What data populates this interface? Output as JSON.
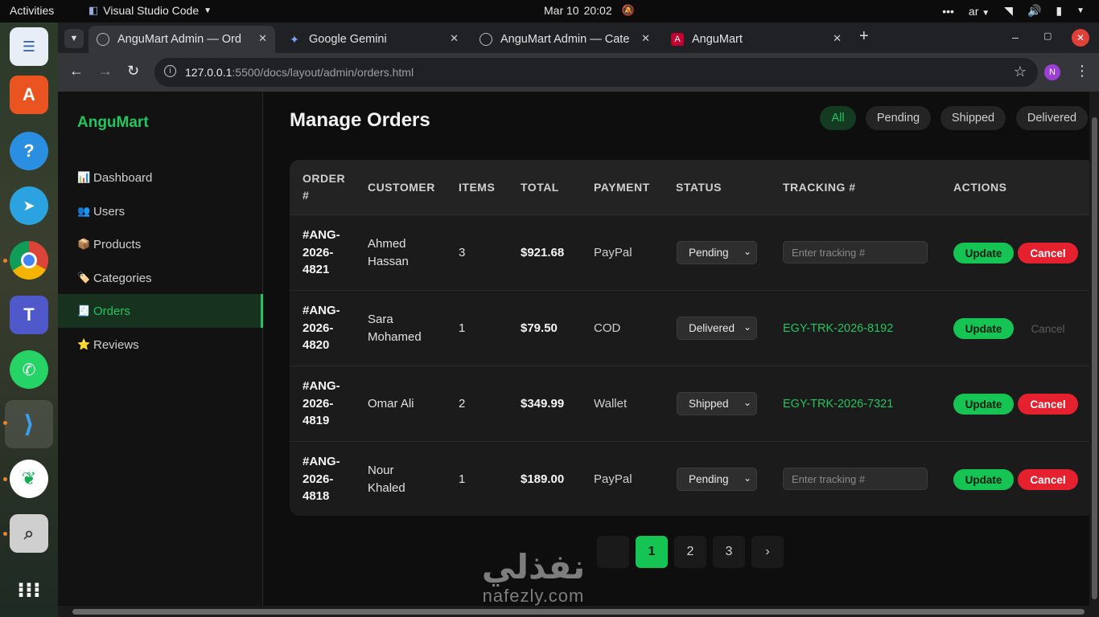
{
  "system": {
    "activities": "Activities",
    "app_name": "Visual Studio Code",
    "date": "Mar 10",
    "time": "20:02",
    "lang": "ar"
  },
  "dock": {
    "apps": [
      "text-editor-icon",
      "app-center-icon",
      "help-icon",
      "telegram-icon",
      "chrome-icon",
      "teams-linux-icon",
      "whatsapp-icon",
      "vscode-icon",
      "mongodb-icon",
      "screenshot-icon",
      "app-grid-icon"
    ]
  },
  "browser": {
    "tabs": [
      {
        "title": "AnguMart Admin — Ord"
      },
      {
        "title": "Google Gemini"
      },
      {
        "title": "AnguMart Admin — Cate"
      },
      {
        "title": "AnguMart"
      }
    ],
    "url_host": "127.0.0.1",
    "url_path": ":5500/docs/layout/admin/orders.html",
    "profile_initial": "N"
  },
  "sidebar": {
    "brand": "AnguMart",
    "items": [
      {
        "icon": "📊",
        "label": "Dashboard"
      },
      {
        "icon": "👥",
        "label": "Users"
      },
      {
        "icon": "📦",
        "label": "Products"
      },
      {
        "icon": "🏷️",
        "label": "Categories"
      },
      {
        "icon": "🧾",
        "label": "Orders"
      },
      {
        "icon": "⭐",
        "label": "Reviews"
      }
    ]
  },
  "main": {
    "title": "Manage Orders",
    "filters": [
      "All",
      "Pending",
      "Shipped",
      "Delivered"
    ],
    "columns": [
      "ORDER #",
      "CUSTOMER",
      "ITEMS",
      "TOTAL",
      "PAYMENT",
      "STATUS",
      "TRACKING #",
      "ACTIONS"
    ],
    "orders": [
      {
        "id": "#ANG-2026-4821",
        "customer": "Ahmed Hassan",
        "items": "3",
        "total": "$921.68",
        "payment": "PayPal",
        "status": "Pending",
        "tracking": "",
        "tracking_placeholder": "Enter tracking #",
        "update": "Update",
        "cancel": "Cancel"
      },
      {
        "id": "#ANG-2026-4820",
        "customer": "Sara Mohamed",
        "items": "1",
        "total": "$79.50",
        "payment": "COD",
        "status": "Delivered",
        "tracking": "EGY-TRK-2026-8192",
        "tracking_placeholder": "",
        "update": "Update",
        "cancel": "Cancel"
      },
      {
        "id": "#ANG-2026-4819",
        "customer": "Omar Ali",
        "items": "2",
        "total": "$349.99",
        "payment": "Wallet",
        "status": "Shipped",
        "tracking": "EGY-TRK-2026-7321",
        "tracking_placeholder": "",
        "update": "Update",
        "cancel": "Cancel"
      },
      {
        "id": "#ANG-2026-4818",
        "customer": "Nour Khaled",
        "items": "1",
        "total": "$189.00",
        "payment": "PayPal",
        "status": "Pending",
        "tracking": "",
        "tracking_placeholder": "Enter tracking #",
        "update": "Update",
        "cancel": "Cancel"
      }
    ],
    "pagination": {
      "pages": [
        "1",
        "2",
        "3"
      ],
      "next": "›",
      "current": "1"
    },
    "watermark": {
      "arabic": "نفذلي",
      "latin": "nafezly.com"
    }
  },
  "colors": {
    "accent": "#22c55e",
    "danger": "#e5202f",
    "background": "#0e0e0e"
  }
}
